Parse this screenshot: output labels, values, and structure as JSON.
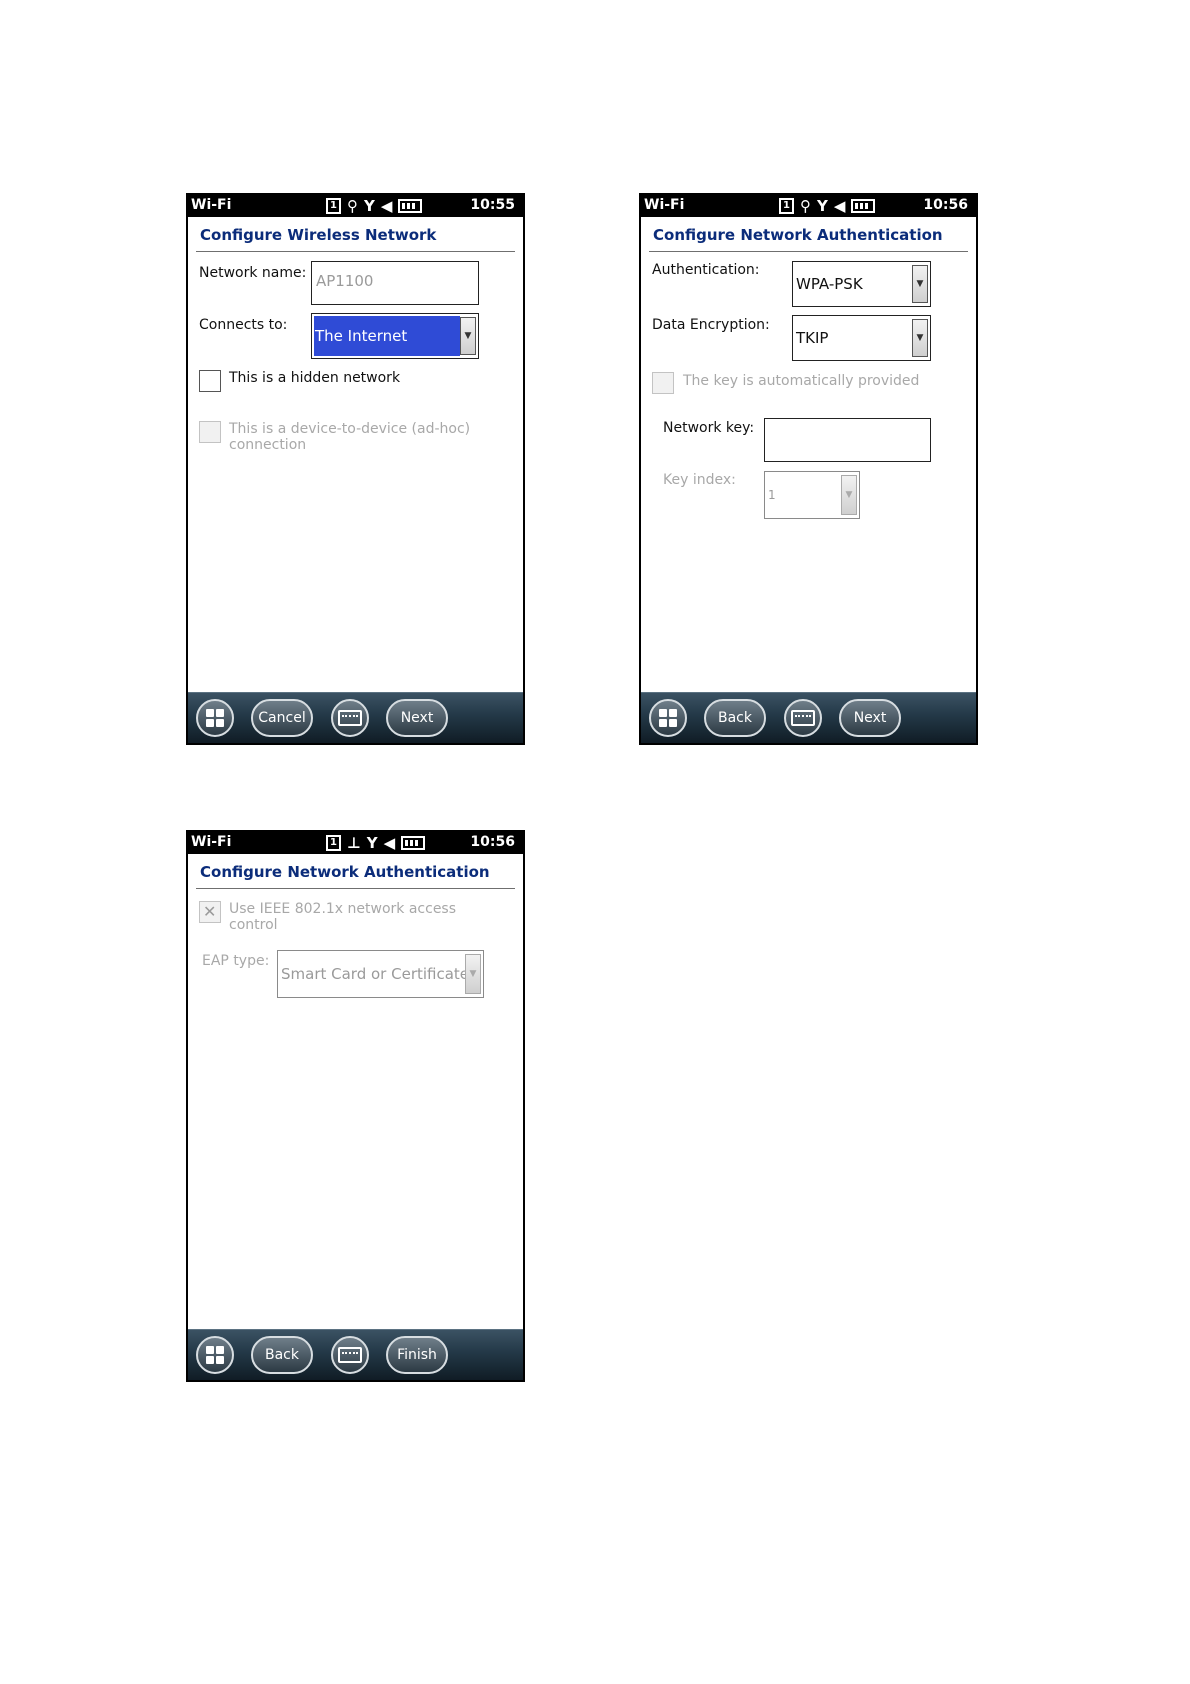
{
  "screens": [
    {
      "status": {
        "app": "Wi-Fi",
        "time": "10:55",
        "icons": [
          "sim-icon",
          "signal-icon",
          "no-network-icon",
          "speaker-icon",
          "battery-icon"
        ]
      },
      "title": "Configure Wireless Network",
      "network_name_label": "Network name:",
      "network_name_value": "AP1100",
      "connects_to_label": "Connects to:",
      "connects_to_value": "The Internet",
      "hidden_label": "This is a hidden network",
      "adhoc_label_line1": "This is a device-to-device (ad-hoc)",
      "adhoc_label_line2": "connection",
      "taskbar": {
        "left": "Cancel",
        "right": "Next"
      }
    },
    {
      "status": {
        "app": "Wi-Fi",
        "time": "10:56",
        "icons": [
          "sim-icon",
          "signal-icon",
          "no-network-icon",
          "speaker-icon",
          "battery-icon"
        ]
      },
      "title": "Configure Network Authentication",
      "auth_label": "Authentication:",
      "auth_value": "WPA-PSK",
      "enc_label": "Data Encryption:",
      "enc_value": "TKIP",
      "auto_key_label": "The key is automatically provided",
      "key_label": "Network key:",
      "key_value": "",
      "key_index_label": "Key index:",
      "key_index_value": "1",
      "taskbar": {
        "left": "Back",
        "right": "Next"
      }
    },
    {
      "status": {
        "app": "Wi-Fi",
        "time": "10:56",
        "icons": [
          "sim-icon",
          "antenna-icon",
          "no-network-icon",
          "speaker-icon",
          "battery-icon"
        ]
      },
      "title": "Configure Network Authentication",
      "ieee_label_line1": "Use IEEE 802.1x network access",
      "ieee_label_line2": "control",
      "eap_label": "EAP type:",
      "eap_value": "Smart Card or Certificate",
      "taskbar": {
        "left": "Back",
        "right": "Finish"
      }
    }
  ],
  "colors": {
    "title": "#0b2c7a",
    "selection": "#2f4bd6",
    "disabled_text": "#a8a8a8"
  },
  "sim_glyph": "1"
}
